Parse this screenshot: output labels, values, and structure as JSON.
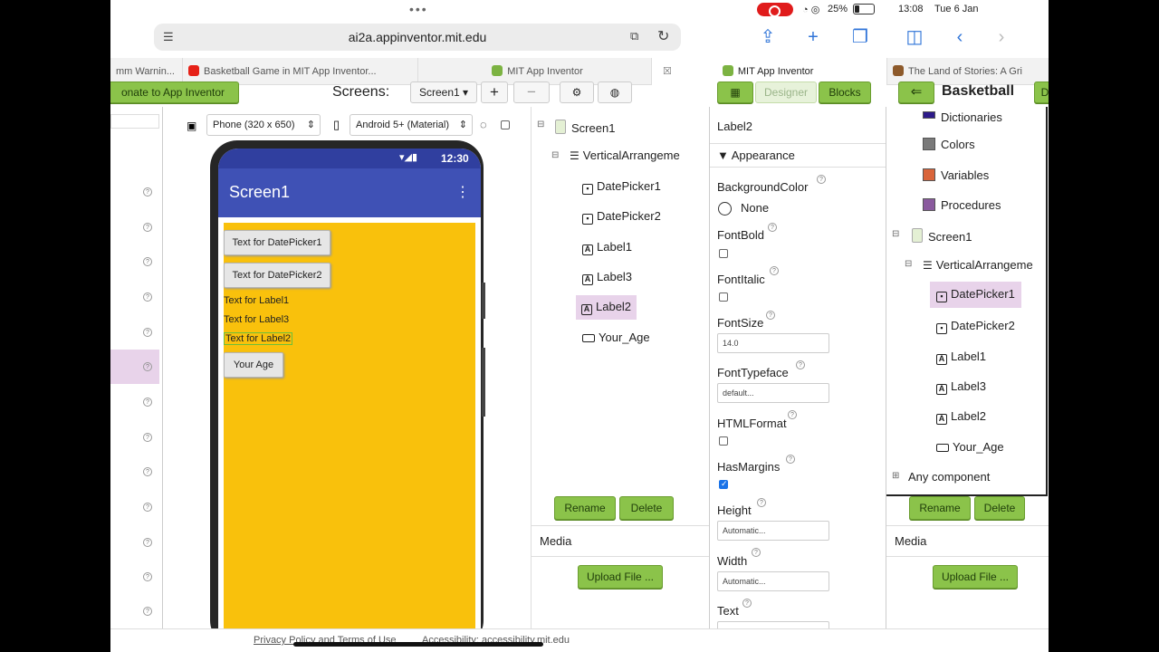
{
  "status": {
    "time": "13:08",
    "date": "Tue 6 Jan",
    "battery": "25%"
  },
  "browser": {
    "url": "ai2a.appinventor.mit.edu"
  },
  "tabs": [
    "mm Warnin...",
    "Basketball Game in MIT App Inventor...",
    "MIT App Inventor",
    "MIT App Inventor",
    "The Land of Stories: A Gri"
  ],
  "toolbar": {
    "donate": "onate to App Inventor",
    "screens_label": "Screens:",
    "screen_select": "Screen1 ▾",
    "add": "+",
    "remove": "−",
    "designer": "Designer",
    "blocks": "Blocks",
    "project": "Basketball",
    "cutoff": "D"
  },
  "viewer": {
    "device": "Phone (320 x 650)",
    "theme": "Android 5+ (Material)",
    "phone_time": "12:30",
    "title": "Screen1",
    "buttons": [
      "Text for DatePicker1",
      "Text for DatePicker2"
    ],
    "labels": [
      "Text for Label1",
      "Text for Label3",
      "Text for Label2"
    ],
    "age_button": "Your Age"
  },
  "components": {
    "items": [
      "Screen1",
      "VerticalArrangeme",
      "DatePicker1",
      "DatePicker2",
      "Label1",
      "Label3",
      "Label2",
      "Your_Age"
    ],
    "rename": "Rename",
    "delete": "Delete",
    "media": "Media",
    "upload": "Upload File ..."
  },
  "properties": {
    "component": "Label2",
    "section": "Appearance",
    "background_color": "BackgroundColor",
    "bg_value": "None",
    "font_bold": "FontBold",
    "font_italic": "FontItalic",
    "font_size": "FontSize",
    "font_size_value": "14.0",
    "font_typeface": "FontTypeface",
    "font_typeface_value": "default...",
    "html_format": "HTMLFormat",
    "has_margins": "HasMargins",
    "height": "Height",
    "height_value": "Automatic...",
    "width": "Width",
    "width_value": "Automatic...",
    "text": "Text"
  },
  "blocks_panel": {
    "builtins": [
      "Dictionaries",
      "Colors",
      "Variables",
      "Procedures"
    ],
    "items": [
      "Screen1",
      "VerticalArrangeme",
      "DatePicker1",
      "DatePicker2",
      "Label1",
      "Label3",
      "Label2",
      "Your_Age"
    ],
    "any": "Any component",
    "rename": "Rename",
    "delete": "Delete",
    "media": "Media",
    "upload": "Upload File ..."
  },
  "footer": {
    "privacy": "Privacy Policy and Terms of Use",
    "accessibility": "Accessibility: accessibility.mit.edu"
  },
  "colors": {
    "green": "#8bc34a",
    "phone_header": "#3f51b5",
    "phone_bg": "#f9c10c",
    "highlight": "#e8d3ea"
  }
}
